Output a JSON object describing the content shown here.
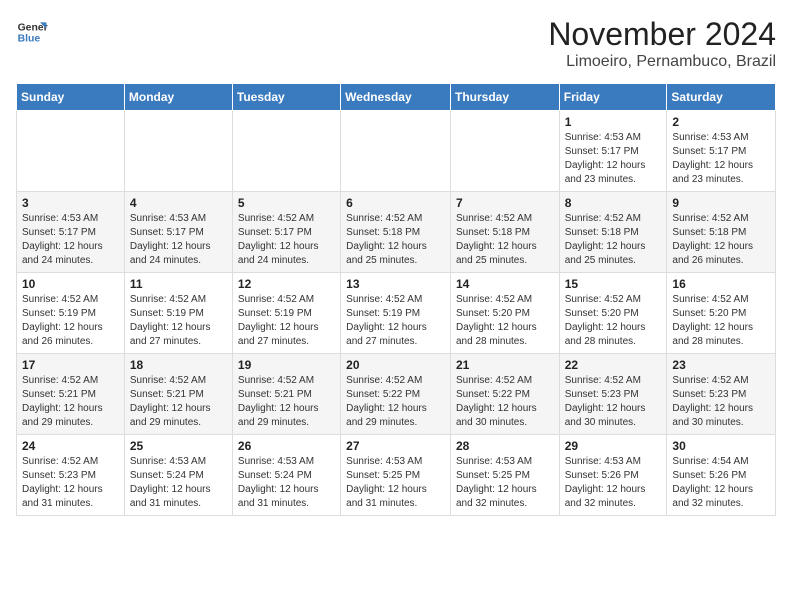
{
  "header": {
    "logo_line1": "General",
    "logo_line2": "Blue",
    "month": "November 2024",
    "location": "Limoeiro, Pernambuco, Brazil"
  },
  "weekdays": [
    "Sunday",
    "Monday",
    "Tuesday",
    "Wednesday",
    "Thursday",
    "Friday",
    "Saturday"
  ],
  "weeks": [
    [
      {
        "day": "",
        "info": ""
      },
      {
        "day": "",
        "info": ""
      },
      {
        "day": "",
        "info": ""
      },
      {
        "day": "",
        "info": ""
      },
      {
        "day": "",
        "info": ""
      },
      {
        "day": "1",
        "info": "Sunrise: 4:53 AM\nSunset: 5:17 PM\nDaylight: 12 hours and 23 minutes."
      },
      {
        "day": "2",
        "info": "Sunrise: 4:53 AM\nSunset: 5:17 PM\nDaylight: 12 hours and 23 minutes."
      }
    ],
    [
      {
        "day": "3",
        "info": "Sunrise: 4:53 AM\nSunset: 5:17 PM\nDaylight: 12 hours and 24 minutes."
      },
      {
        "day": "4",
        "info": "Sunrise: 4:53 AM\nSunset: 5:17 PM\nDaylight: 12 hours and 24 minutes."
      },
      {
        "day": "5",
        "info": "Sunrise: 4:52 AM\nSunset: 5:17 PM\nDaylight: 12 hours and 24 minutes."
      },
      {
        "day": "6",
        "info": "Sunrise: 4:52 AM\nSunset: 5:18 PM\nDaylight: 12 hours and 25 minutes."
      },
      {
        "day": "7",
        "info": "Sunrise: 4:52 AM\nSunset: 5:18 PM\nDaylight: 12 hours and 25 minutes."
      },
      {
        "day": "8",
        "info": "Sunrise: 4:52 AM\nSunset: 5:18 PM\nDaylight: 12 hours and 25 minutes."
      },
      {
        "day": "9",
        "info": "Sunrise: 4:52 AM\nSunset: 5:18 PM\nDaylight: 12 hours and 26 minutes."
      }
    ],
    [
      {
        "day": "10",
        "info": "Sunrise: 4:52 AM\nSunset: 5:19 PM\nDaylight: 12 hours and 26 minutes."
      },
      {
        "day": "11",
        "info": "Sunrise: 4:52 AM\nSunset: 5:19 PM\nDaylight: 12 hours and 27 minutes."
      },
      {
        "day": "12",
        "info": "Sunrise: 4:52 AM\nSunset: 5:19 PM\nDaylight: 12 hours and 27 minutes."
      },
      {
        "day": "13",
        "info": "Sunrise: 4:52 AM\nSunset: 5:19 PM\nDaylight: 12 hours and 27 minutes."
      },
      {
        "day": "14",
        "info": "Sunrise: 4:52 AM\nSunset: 5:20 PM\nDaylight: 12 hours and 28 minutes."
      },
      {
        "day": "15",
        "info": "Sunrise: 4:52 AM\nSunset: 5:20 PM\nDaylight: 12 hours and 28 minutes."
      },
      {
        "day": "16",
        "info": "Sunrise: 4:52 AM\nSunset: 5:20 PM\nDaylight: 12 hours and 28 minutes."
      }
    ],
    [
      {
        "day": "17",
        "info": "Sunrise: 4:52 AM\nSunset: 5:21 PM\nDaylight: 12 hours and 29 minutes."
      },
      {
        "day": "18",
        "info": "Sunrise: 4:52 AM\nSunset: 5:21 PM\nDaylight: 12 hours and 29 minutes."
      },
      {
        "day": "19",
        "info": "Sunrise: 4:52 AM\nSunset: 5:21 PM\nDaylight: 12 hours and 29 minutes."
      },
      {
        "day": "20",
        "info": "Sunrise: 4:52 AM\nSunset: 5:22 PM\nDaylight: 12 hours and 29 minutes."
      },
      {
        "day": "21",
        "info": "Sunrise: 4:52 AM\nSunset: 5:22 PM\nDaylight: 12 hours and 30 minutes."
      },
      {
        "day": "22",
        "info": "Sunrise: 4:52 AM\nSunset: 5:23 PM\nDaylight: 12 hours and 30 minutes."
      },
      {
        "day": "23",
        "info": "Sunrise: 4:52 AM\nSunset: 5:23 PM\nDaylight: 12 hours and 30 minutes."
      }
    ],
    [
      {
        "day": "24",
        "info": "Sunrise: 4:52 AM\nSunset: 5:23 PM\nDaylight: 12 hours and 31 minutes."
      },
      {
        "day": "25",
        "info": "Sunrise: 4:53 AM\nSunset: 5:24 PM\nDaylight: 12 hours and 31 minutes."
      },
      {
        "day": "26",
        "info": "Sunrise: 4:53 AM\nSunset: 5:24 PM\nDaylight: 12 hours and 31 minutes."
      },
      {
        "day": "27",
        "info": "Sunrise: 4:53 AM\nSunset: 5:25 PM\nDaylight: 12 hours and 31 minutes."
      },
      {
        "day": "28",
        "info": "Sunrise: 4:53 AM\nSunset: 5:25 PM\nDaylight: 12 hours and 32 minutes."
      },
      {
        "day": "29",
        "info": "Sunrise: 4:53 AM\nSunset: 5:26 PM\nDaylight: 12 hours and 32 minutes."
      },
      {
        "day": "30",
        "info": "Sunrise: 4:54 AM\nSunset: 5:26 PM\nDaylight: 12 hours and 32 minutes."
      }
    ]
  ]
}
